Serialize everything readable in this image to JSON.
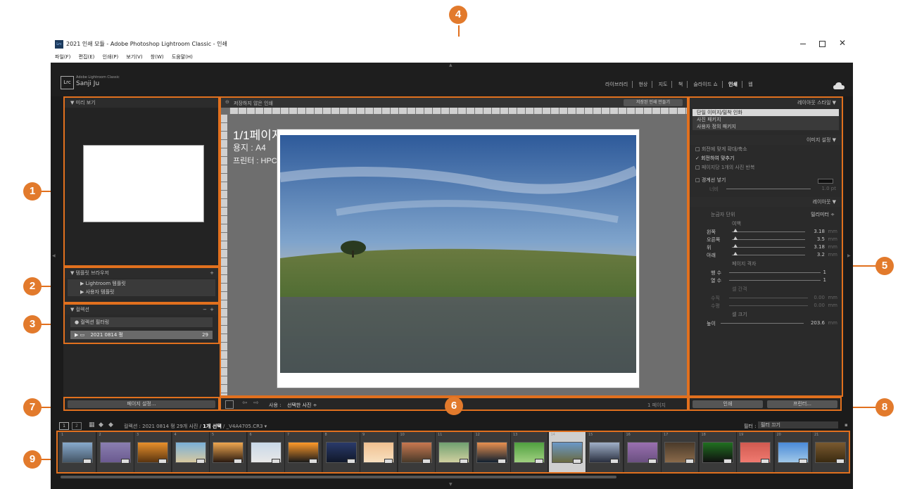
{
  "window": {
    "title": "2021 인쇄 모듈 - Adobe Photoshop Lightroom Classic - 인쇄",
    "app_badge": "Lrc",
    "menus": [
      "파일(F)",
      "편집(E)",
      "인쇄(P)",
      "보기(V)",
      "창(W)",
      "도움말(H)"
    ]
  },
  "identity": {
    "logo": "Lrc",
    "product": "Adobe Lightroom Classic",
    "user": "Sanji Ju"
  },
  "modules": [
    "라이브러리",
    "현상",
    "지도",
    "책",
    "슬라이드 쇼",
    "인쇄",
    "웹"
  ],
  "active_module": "인쇄",
  "left_panel": {
    "preview_header": "미리 보기",
    "template_browser_header": "템플릿 브라우저",
    "template_items": [
      "Lightroom 템플릿",
      "사용자 템플릿"
    ],
    "collections_header": "컬렉션",
    "collection_filter": "컬렉션 필터링",
    "collection_item": {
      "name": "2021 0814 펑",
      "count": "29"
    },
    "page_setup_button": "페이지 설정..."
  },
  "center": {
    "header_title": "저장하지 않은 인쇄",
    "save_button": "저장된 인쇄 만들기",
    "page_label": "1/1페이지",
    "paper_label": "용지 : A4",
    "printer_label": "프린터 : HPC7DED6 (HP Office)...",
    "toolbar_use_label": "사용 :",
    "toolbar_use_value": "선택한 사진",
    "page_count": "1 페이지"
  },
  "right_panel": {
    "layout_style_header": "레이아웃 스타일",
    "layout_styles": [
      "단일 이미지/밀착 인화",
      "사진 패키지",
      "사용자 정의 패키지"
    ],
    "image_settings_header": "이미지 설정",
    "image_options": [
      {
        "label": "회전에 맞게 확대/축소",
        "checked": false
      },
      {
        "label": "회전하여 맞추기",
        "checked": true
      },
      {
        "label": "페이지당 1개의 사진 반복",
        "checked": false
      }
    ],
    "stroke_label": "경계선 넣기",
    "stroke_width_label": "너비",
    "stroke_width_value": "1.0 pt",
    "layout_header": "레이아웃",
    "ruler_units_label": "눈금자 단위",
    "ruler_units_value": "밀리미터",
    "margins_header": "여백",
    "margins": [
      {
        "label": "왼쪽",
        "value": "3.18",
        "fraction": 0.05
      },
      {
        "label": "오른쪽",
        "value": "3.5",
        "fraction": 0.05
      },
      {
        "label": "위",
        "value": "3.18",
        "fraction": 0.05
      },
      {
        "label": "아래",
        "value": "3.2",
        "fraction": 0.05
      }
    ],
    "unit_suffix": "mm",
    "page_grid_header": "페이지 격자",
    "grid": [
      {
        "label": "행 수",
        "value": "1"
      },
      {
        "label": "열 수",
        "value": "1"
      }
    ],
    "spacing_header": "셀 간격",
    "spacing": [
      {
        "label": "수직",
        "value": "0.00"
      },
      {
        "label": "수평",
        "value": "0.00"
      }
    ],
    "cell_size_header": "셀 크기",
    "cell_height_label": "높이",
    "cell_height_value": "203.6",
    "print_button": "인쇄",
    "printer_button": "프린터..."
  },
  "filmstrip": {
    "path_text": "컬렉션 : 2021 0814 펑",
    "count_text": "29개 사진 /",
    "selected_text": "1개 선택",
    "file_text": "/ _V4A4705.CR3",
    "filter_label": "필터 :",
    "filter_value": "필터 끄기",
    "selected_index": 14,
    "cells": [
      {
        "n": "1",
        "colors": [
          "#88aacc",
          "#445566"
        ]
      },
      {
        "n": "2",
        "colors": [
          "#8a7fb0",
          "#6b5a90"
        ]
      },
      {
        "n": "3",
        "colors": [
          "#e8902c",
          "#5a3410"
        ]
      },
      {
        "n": "4",
        "colors": [
          "#7ab0d8",
          "#d8c9a0"
        ]
      },
      {
        "n": "5",
        "colors": [
          "#f0a850",
          "#2a1a10"
        ]
      },
      {
        "n": "6",
        "colors": [
          "#c8d8e8",
          "#e8e8e8"
        ]
      },
      {
        "n": "7",
        "colors": [
          "#ff9a2a",
          "#1a1a1a"
        ]
      },
      {
        "n": "8",
        "colors": [
          "#2a3a6a",
          "#10182a"
        ]
      },
      {
        "n": "9",
        "colors": [
          "#f0c090",
          "#f8e0c0"
        ]
      },
      {
        "n": "10",
        "colors": [
          "#c87850",
          "#4a3a2a"
        ]
      },
      {
        "n": "11",
        "colors": [
          "#70a070",
          "#d0d0a0"
        ]
      },
      {
        "n": "12",
        "colors": [
          "#e89050",
          "#102030"
        ]
      },
      {
        "n": "13",
        "colors": [
          "#50a040",
          "#a0d080"
        ]
      },
      {
        "n": "14",
        "colors": [
          "#6a98c8",
          "#6a6a40"
        ]
      },
      {
        "n": "15",
        "colors": [
          "#a0b0c8",
          "#2a3040"
        ]
      },
      {
        "n": "16",
        "colors": [
          "#9a70b0",
          "#6a5080"
        ]
      },
      {
        "n": "17",
        "colors": [
          "#4a3a2a",
          "#8a6a4a"
        ]
      },
      {
        "n": "18",
        "colors": [
          "#207020",
          "#101010"
        ]
      },
      {
        "n": "19",
        "colors": [
          "#d05a50",
          "#f07a70"
        ]
      },
      {
        "n": "20",
        "colors": [
          "#4a8ad8",
          "#a0c8e8"
        ]
      },
      {
        "n": "21",
        "colors": [
          "#7a5a30",
          "#3a2a10"
        ]
      }
    ]
  },
  "callouts": [
    "1",
    "2",
    "3",
    "4",
    "5",
    "6",
    "7",
    "8",
    "9"
  ],
  "colors": {
    "accent": "#e1701e",
    "callout": "#e27a2c",
    "panel": "#2c2c2c",
    "background": "#1b1b1b"
  }
}
